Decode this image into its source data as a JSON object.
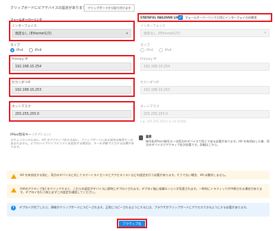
{
  "header": {
    "clipboard_status": "クリップボードにピアデバイスの設定があります",
    "clipboard_button": "クリップボードから貼り付けます"
  },
  "left": {
    "section_title": "フェールオーバーリンク",
    "interface_label": "インターフェイス",
    "interface_value": "指定なし (Ethernet1/3)",
    "type_label": "タイプ",
    "ipv4": "IPv4",
    "ipv6": "IPv6",
    "primary_ip_label": "Primary IP",
    "primary_ip_value": "192.168.10.254",
    "secondary_ip_label": "セカンダリIP",
    "secondary_ip_value": "192.168.10.253",
    "netmask_label": "ネットマスク",
    "netmask_value": "255.255.255.0",
    "ipsec_label": "IPSec暗号キー",
    "ipsec_optional": "(オプション)",
    "ipsec_help": "セキュリティのために、HA をアクティブ化する前に、クリップボードにある設定は暗号キーは含まれません。ピアのハイアベイラビリティを設定する場合は、キーを手動で入力する必要があります。"
  },
  "right": {
    "section_title": "STATEFUL FAILOVER LINK",
    "same_link_checkbox": "フェールオーバーリンクと同じインターフェイスの使用",
    "interface_label": "インターフェイス",
    "interface_value": "指定なし (Ethernet1/3)",
    "type_label": "タイプ",
    "ipv4": "IPv4",
    "ipv6": "IPv6",
    "primary_ip_label": "Primary IP",
    "primary_ip_value": "192.168.10.254",
    "secondary_ip_label": "セカンダリIP",
    "secondary_ip_value": "192.168.10.253",
    "netmask_label": "ネットマスク",
    "netmask_value": "255.255.255.0",
    "netmask_hint": "e.g. 255.255.255.0 or 24 (CIDR)",
    "note_title": "重要",
    "note_text": "暗号化(IPsec)暗号キーは両方のデバイスで同じである必要があります。HA を有効化した後、両方のデバイスでアクティブ化が必要です。詳細はこちら。",
    "note_link": "詳細"
  },
  "banners": {
    "warning1": "HA を有効化する前に、両方のデバイスに対してスマートライセンスとアクセスリストなどの設定を行う必要があります。そうでない場合、HA は動作しません。",
    "warning2": "[HAのアクティブ化] をクリックすると、これらの設定がデバイスに即時にデプロイされます。デプロイ後に候補エンジンが見直されます。一時的にトラフィックが中断される場合があります。デプロイを行う前に必ずこの設定を確認してください。",
    "info": "デプロイが完了したら、情報がクリップボードにコピーされます。正常にコピーされるようにするには、ブラウザがクリップボードにアクセスできるようにする必要があります。"
  },
  "footer": {
    "activate_button": "アクティブ化"
  },
  "colors": {
    "accent": "#1e88e5",
    "highlight": "#e2141b",
    "warning": "#f4a300",
    "info": "#1e88e5"
  }
}
